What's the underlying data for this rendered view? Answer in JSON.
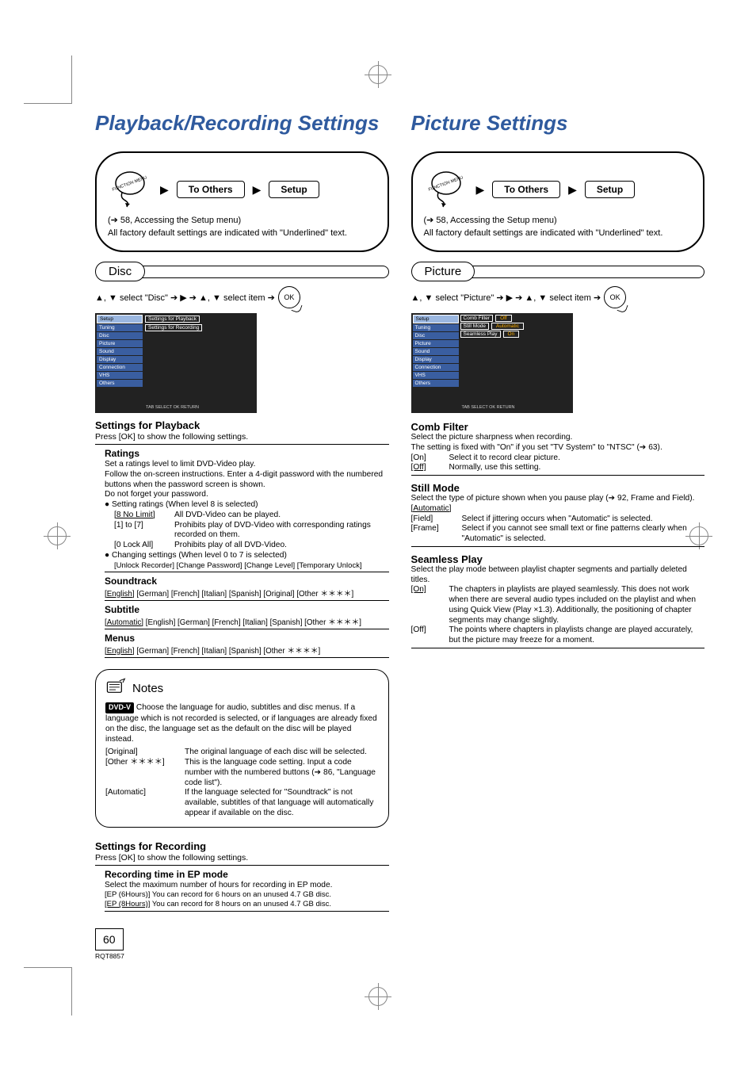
{
  "page_number": "60",
  "page_code": "RQT8857",
  "left": {
    "title": "Playback/Recording Settings",
    "nav": {
      "to_others": "To Others",
      "setup": "Setup"
    },
    "access_line": "(➔ 58, Accessing the Setup menu)",
    "default_line": "All factory default settings are indicated with \"Underlined\" text.",
    "section": "Disc",
    "sel_line_a": "▲, ▼ select \"Disc\" ➔ ▶ ➔ ▲, ▼ select item ➔",
    "ok": "OK",
    "osd": {
      "hdr": "Setup",
      "items": [
        "Tuning",
        "Disc",
        "Picture",
        "Sound",
        "Display",
        "Connection",
        "VHS",
        "Others"
      ],
      "right": [
        "Settings for Playback",
        "Settings for Recording"
      ],
      "remote_hint": "TAB\nSELECT\nOK\nRETURN"
    },
    "playback": {
      "head": "Settings for Playback",
      "sub": "Press [OK] to show the following settings.",
      "ratings": {
        "h": "Ratings",
        "l1": "Set a ratings level to limit DVD-Video play.",
        "l2": "Follow the on-screen instructions. Enter a 4-digit password with the numbered buttons when the password screen is shown.",
        "l3": "Do not forget your password.",
        "b1": "Setting ratings (When level 8 is selected)",
        "r1k": "[8 No Limit]",
        "r1v": "All DVD-Video can be played.",
        "r2k": "[1] to [7]",
        "r2v": "Prohibits play of DVD-Video with corresponding ratings recorded on them.",
        "r3k": "[0 Lock All]",
        "r3v": "Prohibits play of all DVD-Video.",
        "b2": "Changing settings (When level 0 to 7 is selected)",
        "b2opts": "[Unlock Recorder] [Change Password] [Change Level] [Temporary Unlock]"
      },
      "soundtrack": {
        "h": "Soundtrack",
        "opts": "[English] [German] [French] [Italian] [Spanish] [Original] [Other ＊＊＊＊]"
      },
      "subtitle": {
        "h": "Subtitle",
        "opts": "[Automatic] [English] [German] [French] [Italian] [Spanish] [Other ＊＊＊＊]"
      },
      "menus": {
        "h": "Menus",
        "opts": "[English] [German] [French] [Italian] [Spanish] [Other ＊＊＊＊]"
      }
    },
    "notes": {
      "head": "Notes",
      "badge": "DVD-V",
      "body": " Choose the language for audio, subtitles and disc menus. If a language which is not recorded is selected, or if languages are already fixed on the disc, the language set as the default on the disc will be played instead.",
      "r1k": "[Original]",
      "r1v": "The original language of each disc will be selected.",
      "r2k": "[Other ＊＊＊＊]",
      "r2v": "This is the language code setting. Input a code number with the numbered buttons (➔ 86, \"Language code list\").",
      "r3k": "[Automatic]",
      "r3v": "If the language selected for \"Soundtrack\" is not available, subtitles of that language will automatically appear if available on the disc."
    },
    "recording": {
      "head": "Settings for Recording",
      "sub": "Press [OK] to show the following settings.",
      "ep": {
        "h": "Recording time in EP mode",
        "l1": "Select the maximum number of hours for recording in EP mode.",
        "r1": "[EP (6Hours)] You can record for 6 hours on an unused 4.7 GB disc.",
        "r2": "[EP (8Hours)] You can record for 8 hours on an unused 4.7 GB disc."
      }
    }
  },
  "right": {
    "title": "Picture Settings",
    "nav": {
      "to_others": "To Others",
      "setup": "Setup"
    },
    "access_line": "(➔ 58, Accessing the Setup menu)",
    "default_line": "All factory default settings are indicated with \"Underlined\" text.",
    "section": "Picture",
    "sel_line_a": "▲, ▼ select \"Picture\" ➔ ▶ ➔ ▲, ▼ select item ➔",
    "ok": "OK",
    "osd": {
      "hdr": "Setup",
      "items": [
        "Tuning",
        "Disc",
        "Picture",
        "Sound",
        "Display",
        "Connection",
        "VHS",
        "Others"
      ],
      "rows": [
        {
          "k": "Comb Filter",
          "v": "Off"
        },
        {
          "k": "Still Mode",
          "v": "Automatic"
        },
        {
          "k": "Seamless Play",
          "v": "On"
        }
      ],
      "remote_hint": "TAB\nSELECT\nOK\nRETURN"
    },
    "comb": {
      "h": "Comb Filter",
      "l1": "Select the picture sharpness when recording.",
      "l2": "The setting is fixed with \"On\" if you set \"TV System\" to \"NTSC\" (➔ 63).",
      "r1k": "[On]",
      "r1v": "Select it to record clear picture.",
      "r2k": "[Off]",
      "r2v": "Normally, use this setting."
    },
    "still": {
      "h": "Still Mode",
      "l1": "Select the type of picture shown when you pause play (➔ 92, Frame and Field).",
      "r0": "[Automatic]",
      "r1k": "[Field]",
      "r1v": "Select if jittering occurs when \"Automatic\" is selected.",
      "r2k": "[Frame]",
      "r2v": "Select if you cannot see small text or fine patterns clearly when \"Automatic\" is selected."
    },
    "seamless": {
      "h": "Seamless Play",
      "l1": "Select the play mode between playlist chapter segments and partially deleted titles.",
      "r1k": "[On]",
      "r1v": "The chapters in playlists are played seamlessly. This does not work when there are several audio types included on the playlist and when using Quick View (Play ×1.3). Additionally, the positioning of chapter segments may change slightly.",
      "r2k": "[Off]",
      "r2v": "The points where chapters in playlists change are played accurately, but the picture may freeze for a moment."
    }
  }
}
